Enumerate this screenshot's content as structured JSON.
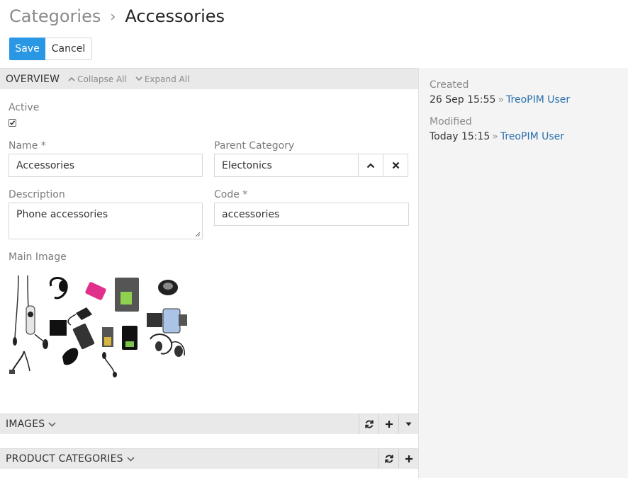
{
  "header": {
    "breadcrumb_parent": "Categories",
    "breadcrumb_separator": "›",
    "title": "Accessories"
  },
  "actions": {
    "save_label": "Save",
    "cancel_label": "Cancel"
  },
  "overview": {
    "title": "OVERVIEW",
    "collapse_all": "Collapse All",
    "expand_all": "Expand All",
    "active_label": "Active",
    "active_checked": true,
    "name_label": "Name *",
    "name_value": "Accessories",
    "parent_category_label": "Parent Category",
    "parent_category_value": "Electonics",
    "description_label": "Description",
    "description_value": "Phone accessories",
    "code_label": "Code *",
    "code_value": "accessories",
    "main_image_label": "Main Image"
  },
  "panels": {
    "images_title": "IMAGES",
    "product_categories_title": "PRODUCT CATEGORIES"
  },
  "side": {
    "created_label": "Created",
    "created_time": "26 Sep 15:55",
    "created_user": "TreoPIM User",
    "modified_label": "Modified",
    "modified_time": "Today 15:15",
    "modified_user": "TreoPIM User",
    "separator": "»"
  },
  "colors": {
    "primary": "#2a97e4",
    "link": "#2a6fad",
    "panel_header": "#e9e9e9",
    "side_bg": "#f4f4f4"
  }
}
